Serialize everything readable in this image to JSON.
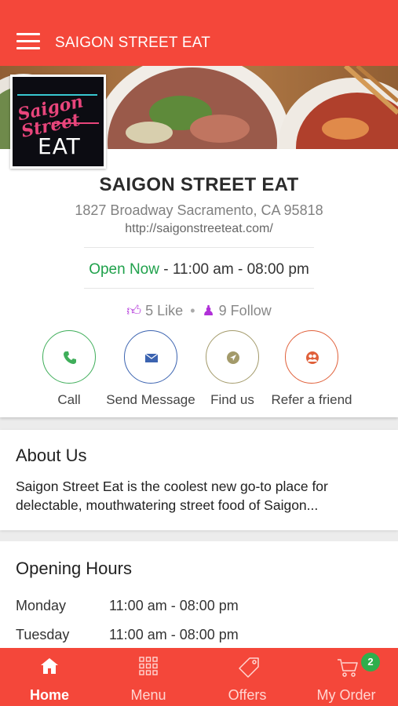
{
  "appbar": {
    "title": "SAIGON STREET EAT"
  },
  "logo": {
    "script_text": "Saigon Street",
    "eat_text": "EAT"
  },
  "business": {
    "name": "SAIGON STREET EAT",
    "address": "1827 Broadway Sacramento, CA 95818",
    "url": "http://saigonstreeteat.com/",
    "open_status": "Open Now",
    "hours_today": " - 11:00 am - 08:00 pm",
    "likes": "5 Like",
    "follows": "9 Follow"
  },
  "actions": [
    {
      "label": "Call",
      "icon": "phone-icon",
      "color": "#3fae5a"
    },
    {
      "label": "Send Message",
      "icon": "mail-icon",
      "color": "#3b63b0"
    },
    {
      "label": "Find us",
      "icon": "location-icon",
      "color": "#a39a6a"
    },
    {
      "label": "Refer a friend",
      "icon": "friends-icon",
      "color": "#e0603a"
    }
  ],
  "about": {
    "title": "About Us",
    "text": "Saigon Street Eat is the coolest new go-to place for delectable, mouthwatering street food of Saigon..."
  },
  "opening_hours": {
    "title": "Opening Hours",
    "rows": [
      {
        "day": "Monday",
        "time": "11:00 am - 08:00 pm"
      },
      {
        "day": "Tuesday",
        "time": "11:00 am - 08:00 pm"
      }
    ]
  },
  "bottom_nav": {
    "items": [
      {
        "label": "Home",
        "icon": "home-icon",
        "active": true
      },
      {
        "label": "Menu",
        "icon": "grid-icon",
        "active": false
      },
      {
        "label": "Offers",
        "icon": "tag-icon",
        "active": false
      },
      {
        "label": "My Order",
        "icon": "cart-icon",
        "active": false
      }
    ],
    "cart_count": "2"
  },
  "colors": {
    "brand": "#f4473a",
    "open": "#1fa14b",
    "social_icon": "#b030d8",
    "badge": "#2fae4c"
  }
}
